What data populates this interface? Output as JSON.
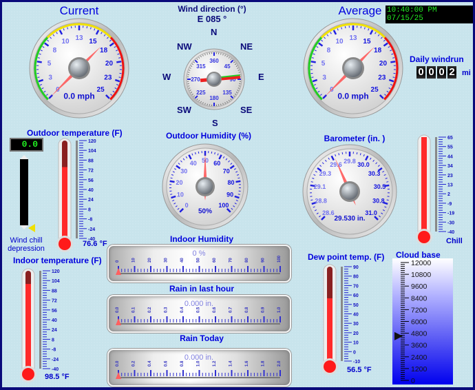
{
  "wind_current": {
    "title": "Current",
    "value_label": "0.0 mph",
    "value": 0.0,
    "scale": [
      "0",
      "3",
      "5",
      "8",
      "10",
      "13",
      "15",
      "18",
      "20",
      "23",
      "25"
    ],
    "max": 25
  },
  "wind_average": {
    "title": "Average",
    "value_label": "0.0 mph",
    "value": 0.0,
    "scale": [
      "0",
      "3",
      "5",
      "8",
      "10",
      "13",
      "15",
      "18",
      "20",
      "23",
      "25"
    ],
    "max": 25
  },
  "clock": "10:40:00 PM 07/15/25",
  "wind_direction": {
    "title": "Wind direction (°)",
    "reading": "E  085 °",
    "degrees": 85,
    "compass": {
      "n": "N",
      "ne": "NE",
      "e": "E",
      "se": "SE",
      "s": "S",
      "sw": "SW",
      "w": "W",
      "nw": "NW"
    },
    "dial_labels": [
      "360",
      "45",
      "90",
      "135",
      "180",
      "225",
      "270",
      "315"
    ]
  },
  "daily_windrun": {
    "title": "Daily windrun",
    "digits": [
      "0",
      "0",
      "0",
      "2"
    ],
    "unit": "mi"
  },
  "outdoor_temp": {
    "title": "Outdoor temperature (F)",
    "value_label": "76.6 °F",
    "value": 76.6,
    "min": -40,
    "max": 120,
    "scale": [
      "120",
      "104",
      "88",
      "72",
      "56",
      "40",
      "24",
      "8",
      "-8",
      "-24",
      "-40"
    ]
  },
  "wind_chill": {
    "lcd": "0.0",
    "label_line1": "Wind chill",
    "label_line2": "depression"
  },
  "outdoor_humidity": {
    "title": "Outdoor Humidity (%)",
    "value_label": "50%",
    "value": 50,
    "scale": [
      "0",
      "10",
      "20",
      "30",
      "40",
      "50",
      "60",
      "70",
      "80",
      "90",
      "100"
    ]
  },
  "barometer": {
    "title": "Barometer (in. )",
    "value_label": "29.530 in.",
    "value": 29.53,
    "scale": [
      "28.6",
      "28.8",
      "29.1",
      "29.3",
      "29.6",
      "29.8",
      "30.0",
      "30.3",
      "30.5",
      "30.8",
      "31.0"
    ]
  },
  "chill": {
    "label": "Chill",
    "value": 65,
    "min": -40,
    "max": 65,
    "scale": [
      "65",
      "55",
      "44",
      "34",
      "23",
      "13",
      "2",
      "-9",
      "-19",
      "-30",
      "-40"
    ]
  },
  "indoor_temp": {
    "title": "Indoor temperature (F)",
    "value_label": "98.5 °F",
    "value": 98.5,
    "min": -40,
    "max": 120,
    "scale": [
      "120",
      "104",
      "88",
      "72",
      "56",
      "40",
      "24",
      "8",
      "-8",
      "-24",
      "-40"
    ]
  },
  "indoor_humidity": {
    "title": "Indoor Humidity",
    "value_label": "0 %",
    "value": 0,
    "scale": [
      "0",
      "10",
      "20",
      "30",
      "40",
      "50",
      "60",
      "70",
      "80",
      "90",
      "100"
    ]
  },
  "rain_hour": {
    "title": "Rain in last hour",
    "value_label": "0.000 in.",
    "value": 0,
    "scale": [
      "0.0",
      "0.1",
      "0.2",
      "0.3",
      "0.4",
      "0.5",
      "0.6",
      "0.7",
      "0.8",
      "0.9",
      "1.0"
    ]
  },
  "rain_today": {
    "title": "Rain Today",
    "value_label": "0.000 in.",
    "value": 0,
    "scale": [
      "0.0",
      "0.2",
      "0.4",
      "0.6",
      "0.8",
      "1.0",
      "1.2",
      "1.4",
      "1.6",
      "1.8",
      "2.0"
    ]
  },
  "dew_point": {
    "title": "Dew point temp. (F)",
    "value_label": "56.5 °F",
    "value": 56.5,
    "min": -10,
    "max": 90,
    "scale": [
      "90",
      "80",
      "70",
      "60",
      "50",
      "40",
      "30",
      "20",
      "10",
      "0",
      "-10"
    ]
  },
  "cloud_base": {
    "title": "Cloud base",
    "value": 4500,
    "min": 0,
    "max": 12000,
    "scale": [
      "12000",
      "10800",
      "9600",
      "8400",
      "7200",
      "6000",
      "4800",
      "3600",
      "2400",
      "1200",
      "0"
    ]
  }
}
